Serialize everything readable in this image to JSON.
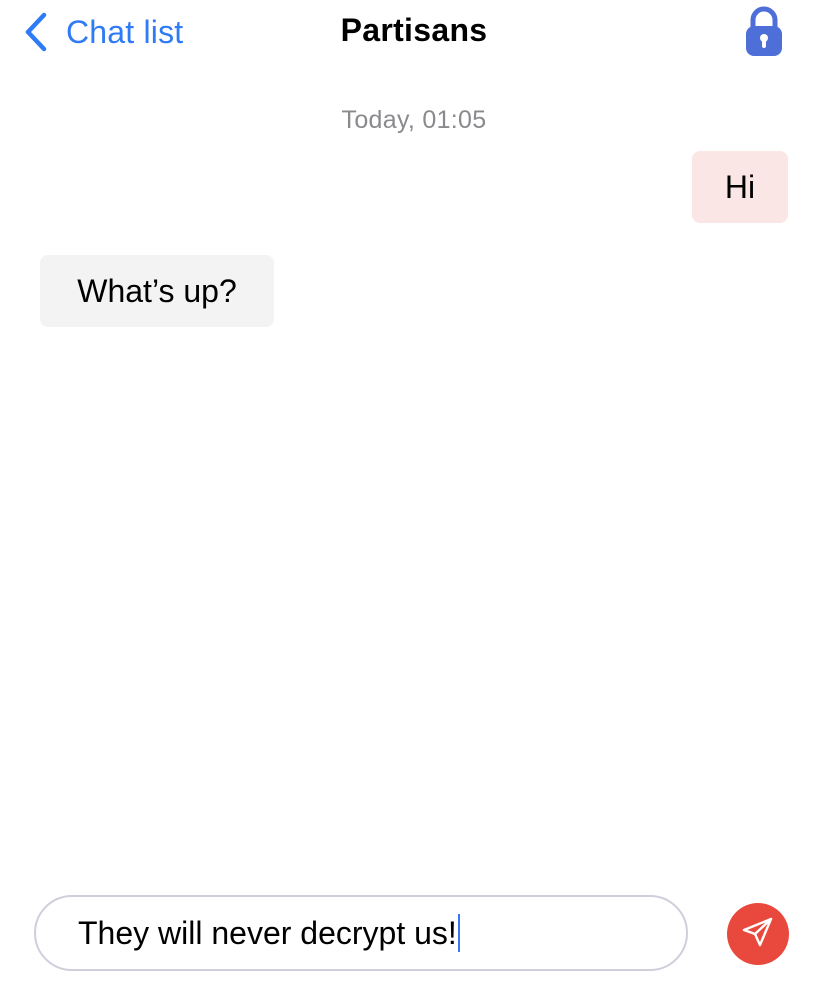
{
  "header": {
    "back_label": "Chat list",
    "title": "Partisans"
  },
  "chat": {
    "timestamp": "Today, 01:05",
    "messages": [
      {
        "direction": "outgoing",
        "text": "Hi"
      },
      {
        "direction": "incoming",
        "text": "What’s up?"
      }
    ]
  },
  "composer": {
    "value": "They will never decrypt us!"
  },
  "icons": {
    "back": "chevron-left-icon",
    "lock": "lock-icon",
    "send": "paper-plane-icon"
  },
  "colors": {
    "accent_blue": "#2f7bf5",
    "lock_blue": "#4f6fd8",
    "send_red": "#e8493c",
    "outgoing_bubble": "#fbe6e6",
    "incoming_bubble": "#f3f3f3"
  }
}
